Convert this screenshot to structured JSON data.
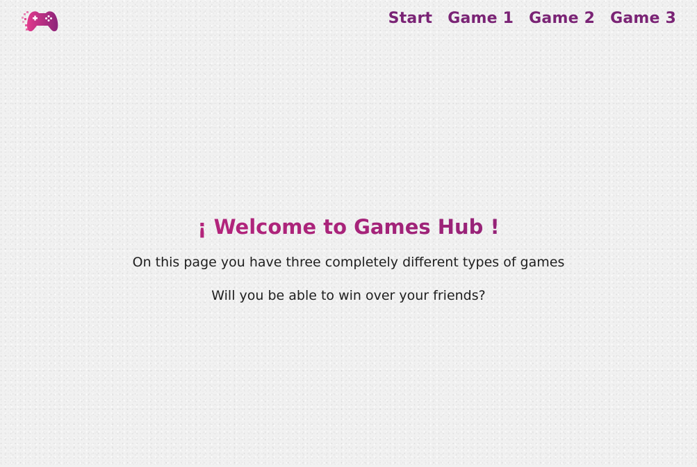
{
  "header": {
    "logo_icon": "gamepad-icon",
    "nav": {
      "start": "Start",
      "game1": "Game 1",
      "game2": "Game 2",
      "game3": "Game 3"
    }
  },
  "hero": {
    "title": "¡ Welcome to Games Hub !",
    "line1": "On this page you have three completely different types of games",
    "line2": "Will you be able to win over your friends?"
  },
  "colors": {
    "nav_text": "#7a2375",
    "title_gradient_start": "#c2267d",
    "title_gradient_end": "#7b2273",
    "background": "#f1f1f1"
  }
}
